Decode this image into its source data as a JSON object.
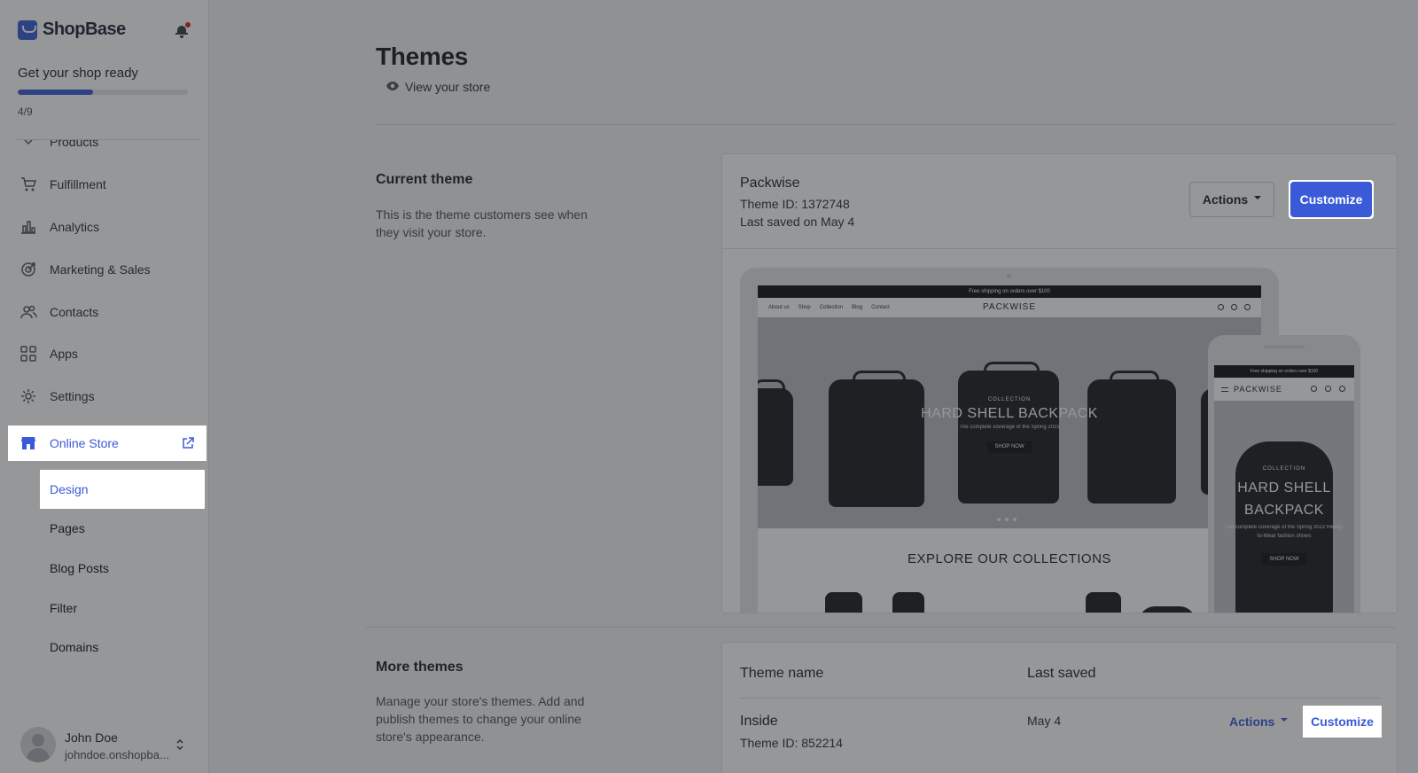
{
  "app": {
    "brand": "ShopBase",
    "notification_dot_color": "#e51c23",
    "accent_color": "#3a5ad8"
  },
  "sidebar": {
    "setup": {
      "title": "Get your shop ready",
      "progress_fraction": 0.444,
      "count": "4/9"
    },
    "partial_item": "Products",
    "items": [
      {
        "label": "Fulfillment",
        "icon": "cart-icon"
      },
      {
        "label": "Analytics",
        "icon": "bar-chart-icon"
      },
      {
        "label": "Marketing & Sales",
        "icon": "target-icon"
      },
      {
        "label": "Contacts",
        "icon": "people-icon"
      },
      {
        "label": "Apps",
        "icon": "apps-grid-icon"
      },
      {
        "label": "Settings",
        "icon": "gear-icon"
      },
      {
        "label": "Online Store",
        "icon": "store-icon",
        "active": true
      }
    ],
    "sub_items": [
      {
        "label": "Design",
        "active": true
      },
      {
        "label": "Pages"
      },
      {
        "label": "Blog Posts"
      },
      {
        "label": "Filter"
      },
      {
        "label": "Domains"
      }
    ],
    "user": {
      "name": "John Doe",
      "email": "johndoe.onshopba..."
    }
  },
  "page": {
    "title": "Themes",
    "view_store": "View your store",
    "current_theme": {
      "section_title": "Current theme",
      "section_desc": "This is the theme customers see when they visit your store.",
      "name": "Packwise",
      "theme_id": "Theme ID: 1372748",
      "last_saved": "Last saved on May 4",
      "actions_label": "Actions",
      "customize_label": "Customize"
    },
    "preview": {
      "announcement": "Free shipping on orders over $100",
      "nav_links": [
        "About us",
        "Shop",
        "Collection",
        "Blog",
        "Contact"
      ],
      "brand": "PACKWISE",
      "hero_sub": "COLLECTION",
      "hero_title": "HARD SHELL BACKPACK",
      "hero_tagline": "The complete coverage of the Spring 2022",
      "hero_button": "SHOP NOW",
      "explore": "EXPLORE OUR COLLECTIONS",
      "phone_announcement": "Free shipping on orders over $100",
      "phone_brand": "PACKWISE",
      "phone_hero_sub": "COLLECTION",
      "phone_hero_title": "HARD SHELL BACKPACK",
      "phone_hero_tagline": "The complete coverage of the Spring 2022 Ready-to-Wear fashion shows",
      "phone_hero_button": "SHOP NOW"
    },
    "more_themes": {
      "section_title": "More themes",
      "section_desc": "Manage your store's themes. Add and publish themes to change your online store's appearance.",
      "col_name": "Theme name",
      "col_saved": "Last saved",
      "rows": [
        {
          "name": "Inside",
          "theme_id": "Theme ID: 852214",
          "last_saved": "May 4",
          "actions_label": "Actions",
          "customize_label": "Customize"
        }
      ]
    }
  }
}
